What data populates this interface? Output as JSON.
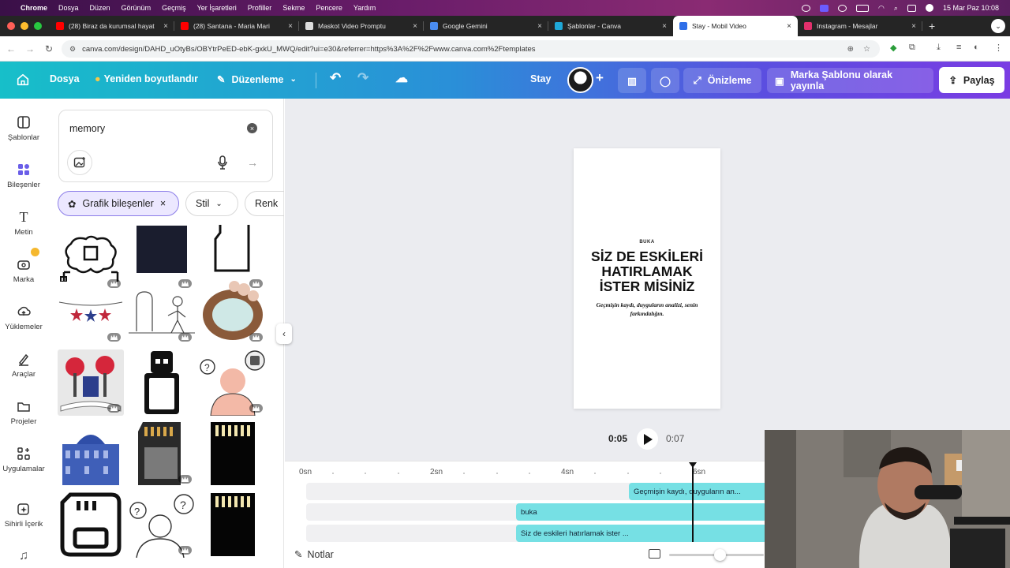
{
  "os_menubar": {
    "app": "Chrome",
    "menus": [
      "Dosya",
      "Düzen",
      "Görünüm",
      "Geçmiş",
      "Yer İşaretleri",
      "Profiller",
      "Sekme",
      "Pencere",
      "Yardım"
    ],
    "datetime": "15 Mar Paz  10:08"
  },
  "browser": {
    "tabs": [
      {
        "title": "(28) Biraz da kurumsal hayat",
        "favicon_color": "#ff0000"
      },
      {
        "title": "(28) Santana - Maria Mari",
        "favicon_color": "#ff0000"
      },
      {
        "title": "Maskot Video Promptu",
        "favicon_color": "#dddddd"
      },
      {
        "title": "Google Gemini",
        "favicon_color": "#4a8cf0"
      },
      {
        "title": "Şablonlar - Canva",
        "favicon_color": "#1fa8d8"
      },
      {
        "title": "Stay - Mobil Video",
        "favicon_color": "#2e6ee8"
      },
      {
        "title": "Instagram - Mesajlar",
        "favicon_color": "#e1306c"
      }
    ],
    "active_tab": 5,
    "url": "canva.com/design/DAHD_uOtyBs/OBYtrPeED-ebK-gxkU_MWQ/edit?ui=e30&referrer=https%3A%2F%2Fwww.canva.com%2Ftemplates"
  },
  "canva_header": {
    "file": "Dosya",
    "resize": "Yeniden boyutlandır",
    "edit": "Düzenleme",
    "design_name": "Stay",
    "preview": "Önizleme",
    "publish_template": "Marka Şablonu olarak yayınla",
    "share": "Paylaş"
  },
  "left_rail": [
    {
      "label": "Şablonlar",
      "icon": "templates-icon"
    },
    {
      "label": "Bileşenler",
      "icon": "elements-icon"
    },
    {
      "label": "Metin",
      "icon": "text-icon"
    },
    {
      "label": "Marka",
      "icon": "brand-icon"
    },
    {
      "label": "Yüklemeler",
      "icon": "upload-icon"
    },
    {
      "label": "Araçlar",
      "icon": "tools-icon"
    },
    {
      "label": "Projeler",
      "icon": "projects-icon"
    },
    {
      "label": "Uygulamalar",
      "icon": "apps-icon"
    },
    {
      "label": "Sihirli İçerik",
      "icon": "magic-icon"
    }
  ],
  "panel": {
    "search_value": "memory",
    "chips": [
      "Grafik bileşenler",
      "Stil",
      "Renk"
    ]
  },
  "design_page": {
    "brand": "BUKA",
    "headline_lines": [
      "SİZ DE ESKİLERİ",
      "HATIRLAMAK",
      "İSTER MİSİNİZ"
    ],
    "subtitle": "Geçmişin kaydı, duyguların analizi, senin farkındalığın."
  },
  "playback": {
    "current": "0:05",
    "total": "0:07"
  },
  "timeline": {
    "ticks": [
      "0sn",
      "2sn",
      "4sn",
      "6sn"
    ],
    "clips": [
      {
        "label": "Geçmişin kaydı, duyguların an..."
      },
      {
        "label": "buka"
      },
      {
        "label": "Siz de eskileri hatırlamak ister ..."
      }
    ],
    "notes": "Notlar"
  },
  "colors": {
    "header_gradient_start": "#17bfc9",
    "header_gradient_end": "#7a3ce3",
    "clip": "#76e0e4",
    "active_chip_bg": "#ece8ff"
  }
}
